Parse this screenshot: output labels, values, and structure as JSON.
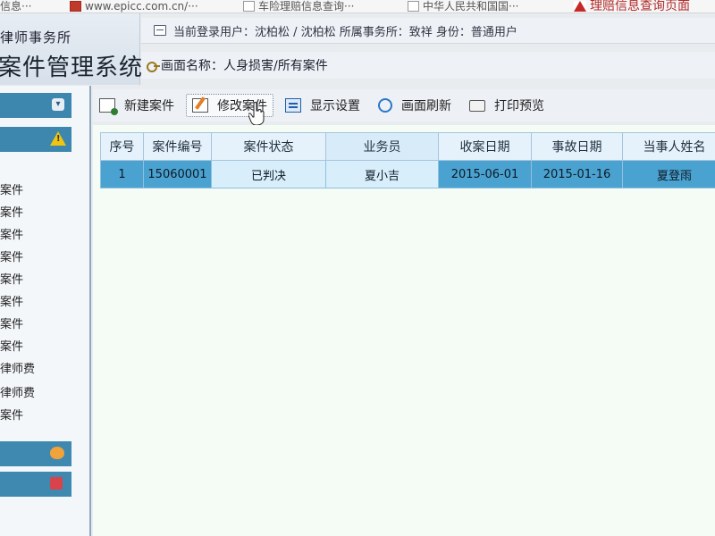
{
  "bookmarks": [
    {
      "text": "信息···",
      "icon": "page-icon"
    },
    {
      "text": "www.epicc.com.cn/···",
      "icon": "picc-icon"
    },
    {
      "text": "车险理赔信息查询···",
      "icon": "page-icon"
    },
    {
      "text": "中华人民共和国国···",
      "icon": "page-icon"
    },
    {
      "text": "理赔信息查询页面",
      "icon": "warning-icon"
    }
  ],
  "header": {
    "firm_name": "律师事务所",
    "system_title": "案件管理系统",
    "current_user_line": "当前登录用户：沈柏松 / 沈柏松  所属事务所：致祥  身份：普通用户",
    "screen_name_line": "画面名称：人身损害/所有案件"
  },
  "sidebar": {
    "items": [
      "案件",
      "案件",
      "案件",
      "案件",
      "案件",
      "案件",
      "案件",
      "案件",
      "律师费",
      "律师费",
      "案件"
    ]
  },
  "toolbar": {
    "new_case": "新建案件",
    "edit_case": "修改案件",
    "display_settings": "显示设置",
    "refresh": "画面刷新",
    "print_preview": "打印预览"
  },
  "table": {
    "headers": [
      "序号",
      "案件编号",
      "案件状态",
      "业务员",
      "收案日期",
      "事故日期",
      "当事人姓名"
    ],
    "rows": [
      [
        "1",
        "15060001",
        "已判决",
        "夏小吉",
        "2015-06-01",
        "2015-01-16",
        "夏登雨"
      ]
    ]
  },
  "colors": {
    "sidebar_header": "#3d86ad",
    "row_selected": "#4aa2d0",
    "header_cell": "#e6f2fb"
  }
}
